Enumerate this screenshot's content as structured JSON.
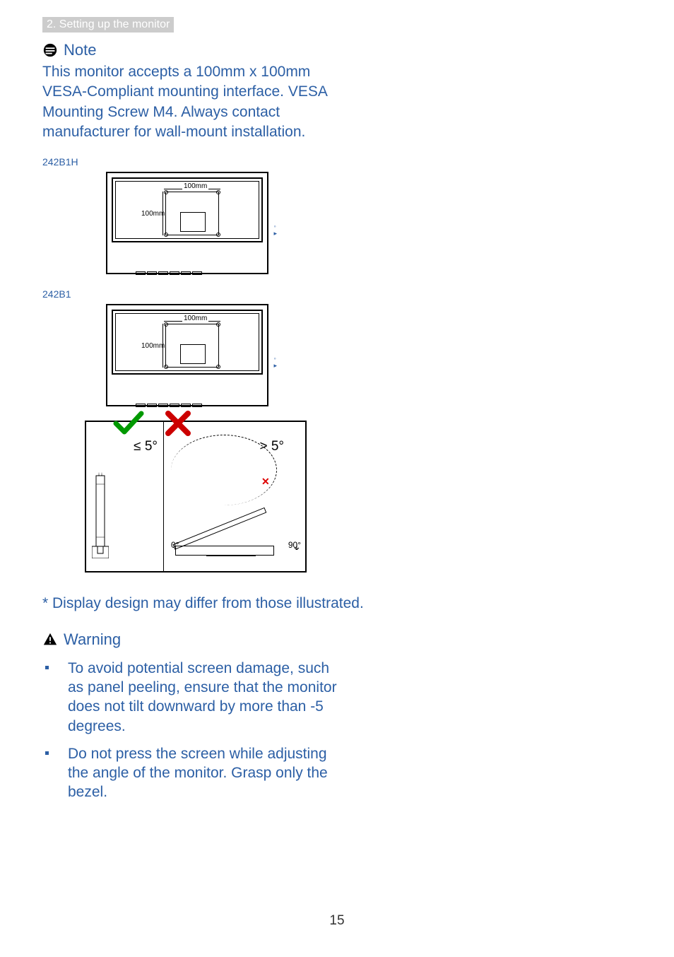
{
  "header": {
    "section": "2. Setting up the monitor"
  },
  "note": {
    "title": "Note",
    "body": "This monitor accepts a 100mm x 100mm VESA-Compliant mounting interface. VESA Mounting Screw M4. Always contact manufacturer for wall-mount installation."
  },
  "models": [
    {
      "name": "242B1H",
      "dim_h": "100mm",
      "dim_v": "100mm"
    },
    {
      "name": "242B1",
      "dim_h": "100mm",
      "dim_v": "100mm"
    }
  ],
  "tilt": {
    "ok_label": "≤ 5°",
    "bad_label": "> 5°",
    "angle_zero": "0°",
    "angle_ninety": "90°"
  },
  "disclaimer": "* Display design may differ from those illustrated.",
  "warning": {
    "title": "Warning",
    "items": [
      "To avoid potential screen damage, such as panel peeling, ensure that the monitor does not tilt downward by more than -5 degrees.",
      "Do not press the screen while adjusting the angle of the monitor. Grasp only the bezel."
    ]
  },
  "page_number": "15"
}
